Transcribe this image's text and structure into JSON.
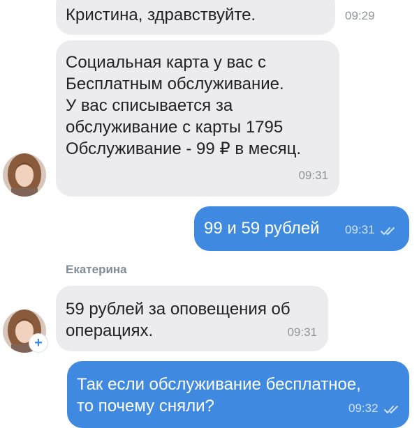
{
  "messages": [
    {
      "text": "Кристина, здравствуйте.",
      "time": "09:29"
    },
    {
      "text": "Социальная карта у вас с\nБесплатным  обслуживание.\nУ вас списывается за\nобслуживание с карты 1795\nОбслуживание - 99 ₽ в месяц.",
      "time": "09:31"
    },
    {
      "text": "99 и 59 рублей",
      "time": "09:31"
    },
    {
      "text": "59 рублей за оповещения об\nоперациях.",
      "time": "09:31"
    },
    {
      "text": "Так если обслуживание бесплатное,\nто почему сняли?",
      "time": "09:32"
    }
  ],
  "sender_name": "Екатерина",
  "badge": "+",
  "colors": {
    "incoming_bubble": "#ececef",
    "outgoing_bubble": "#3f8ae0",
    "accent": "#3f8ae0"
  },
  "icons": [
    "avatar",
    "double-check-icon",
    "add-badge-icon"
  ]
}
